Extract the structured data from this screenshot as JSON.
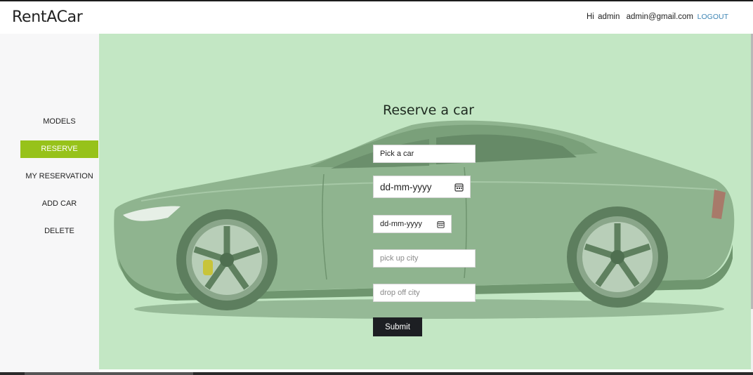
{
  "app": {
    "brand": "RentACar",
    "greeting_prefix": "Hi",
    "user_name": "admin",
    "user_email": "admin@gmail.com",
    "logout_label": "LOGOUT"
  },
  "sidebar": {
    "items": [
      {
        "label": "MODELS",
        "active": false
      },
      {
        "label": "RESERVE",
        "active": true
      },
      {
        "label": "MY RESERVATION",
        "active": false
      },
      {
        "label": "ADD CAR",
        "active": false
      },
      {
        "label": "DELETE",
        "active": false
      }
    ]
  },
  "form": {
    "title": "Reserve a car",
    "car_select": "Pick a car",
    "start_date_placeholder": "dd-mm-yyyy",
    "end_date_placeholder": "dd-mm-yyyy",
    "pickup_placeholder": "pick up city",
    "dropoff_placeholder": "drop off city",
    "submit_label": "Submit"
  },
  "colors": {
    "accent": "#97c21a",
    "main_bg": "#c3e7c4",
    "sidebar_bg": "#f7f7f8",
    "button_bg": "#1d1f23",
    "logout": "#3f86b5"
  }
}
